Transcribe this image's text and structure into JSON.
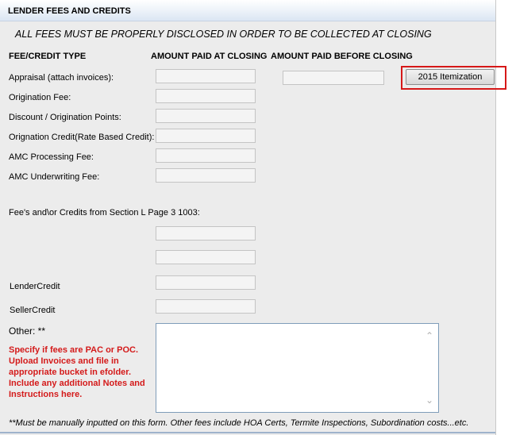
{
  "header": {
    "title": "LENDER FEES AND CREDITS"
  },
  "subtitle": "ALL FEES MUST BE PROPERLY DISCLOSED IN ORDER TO BE COLLECTED AT CLOSING",
  "columns": {
    "type": "FEE/CREDIT TYPE",
    "at_closing": "AMOUNT PAID AT CLOSING",
    "before_closing": "AMOUNT PAID BEFORE CLOSING"
  },
  "rows": [
    {
      "label": "Appraisal (attach invoices):",
      "value": ""
    },
    {
      "label": "Origination Fee:",
      "value": ""
    },
    {
      "label": "Discount / Origination Points:",
      "value": ""
    },
    {
      "label": "Orignation Credit(Rate Based Credit):",
      "value": ""
    },
    {
      "label": "AMC Processing Fee:",
      "value": ""
    },
    {
      "label": "AMC Underwriting Fee:",
      "value": ""
    }
  ],
  "appraisal_before_value": "",
  "itemization_button": "2015 Itemization",
  "section_l_label": "Fee's and\\or Credits from Section L Page 3 1003:",
  "section_l_values": [
    "",
    ""
  ],
  "lender_credit": {
    "label": "LenderCredit",
    "value": ""
  },
  "seller_credit": {
    "label": "SellerCredit",
    "value": ""
  },
  "other": {
    "label": "Other: **",
    "value": ""
  },
  "red_note": "Specify if fees are PAC or POC. Upload Invoices and file in appropriate bucket in efolder. Include any additional Notes and Instructions here.",
  "footer_note": "**Must be manually inputted on this form. Other fees include HOA Certs, Termite Inspections, Subordination costs...etc.",
  "colors": {
    "accent_red": "#d61818",
    "header_gradient_end": "#dbe6f3"
  }
}
